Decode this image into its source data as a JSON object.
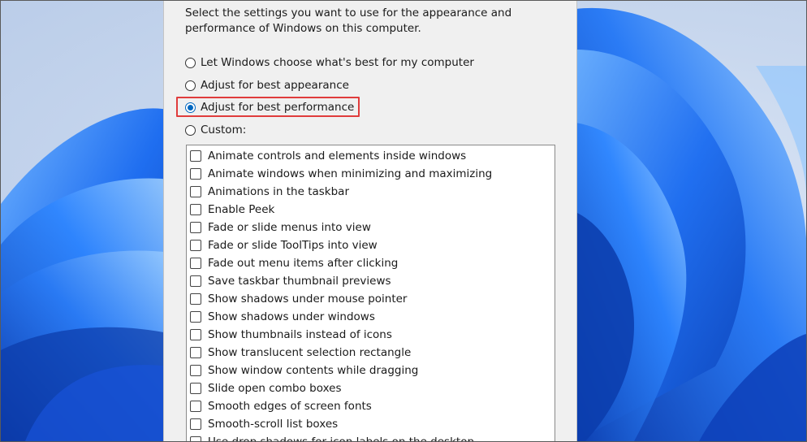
{
  "dialog": {
    "intro_line1": "Select the settings you want to use for the appearance and",
    "intro_line2": "performance of Windows on this computer.",
    "options": [
      {
        "label": "Let Windows choose what's best for my computer",
        "selected": false
      },
      {
        "label": "Adjust for best appearance",
        "selected": false
      },
      {
        "label": "Adjust for best performance",
        "selected": true
      },
      {
        "label": "Custom:",
        "selected": false
      }
    ],
    "effects": [
      {
        "label": "Animate controls and elements inside windows",
        "checked": false
      },
      {
        "label": "Animate windows when minimizing and maximizing",
        "checked": false
      },
      {
        "label": "Animations in the taskbar",
        "checked": false
      },
      {
        "label": "Enable Peek",
        "checked": false
      },
      {
        "label": "Fade or slide menus into view",
        "checked": false
      },
      {
        "label": "Fade or slide ToolTips into view",
        "checked": false
      },
      {
        "label": "Fade out menu items after clicking",
        "checked": false
      },
      {
        "label": "Save taskbar thumbnail previews",
        "checked": false
      },
      {
        "label": "Show shadows under mouse pointer",
        "checked": false
      },
      {
        "label": "Show shadows under windows",
        "checked": false
      },
      {
        "label": "Show thumbnails instead of icons",
        "checked": false
      },
      {
        "label": "Show translucent selection rectangle",
        "checked": false
      },
      {
        "label": "Show window contents while dragging",
        "checked": false
      },
      {
        "label": "Slide open combo boxes",
        "checked": false
      },
      {
        "label": "Smooth edges of screen fonts",
        "checked": false
      },
      {
        "label": "Smooth-scroll list boxes",
        "checked": false
      },
      {
        "label": "Use drop shadows for icon labels on the desktop",
        "checked": false
      }
    ]
  },
  "colors": {
    "accent": "#0067c0",
    "highlight_border": "#e03c3c",
    "wallpaper_blue": "#1a5fe0"
  }
}
